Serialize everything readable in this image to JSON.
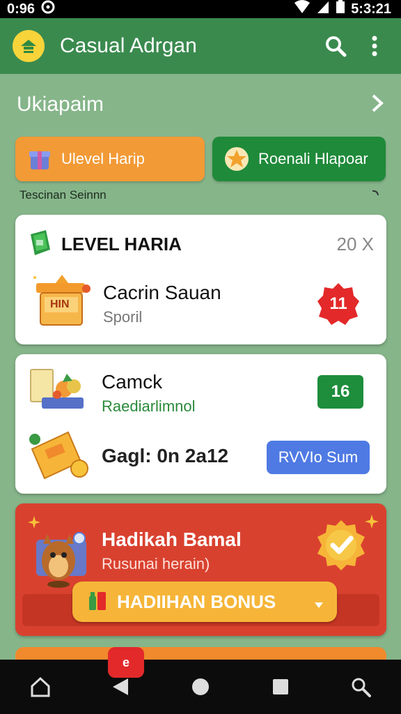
{
  "status_bar": {
    "time": "0:96",
    "clock": "5:3:21"
  },
  "app_bar": {
    "title": "Casual Adrgan",
    "icons": [
      "home-logo-icon",
      "search-icon",
      "more-vert-icon"
    ]
  },
  "section": {
    "title": "Ukiapaim"
  },
  "tabs": [
    {
      "label": "Ulevel Harip",
      "color": "#f29a36"
    },
    {
      "label": "Roenali Hlapoar",
      "color": "#1f8a3a"
    }
  ],
  "subtitle": "Tescinan Seinnn",
  "level_card": {
    "heading": "LEVEL HARIA",
    "count": "20 X",
    "item": {
      "title": "Cacrin Sauan",
      "subtitle": "Sporil",
      "badge": "11",
      "icon_text": "HIN"
    }
  },
  "second_card": {
    "item1": {
      "title": "Camck",
      "subtitle": "Raediarlimnol",
      "badge": "16"
    },
    "item2": {
      "title": "Gagl: 0n 2a12",
      "button": "RVVIo Sum"
    }
  },
  "bonus_card": {
    "title": "Hadikah Bamal",
    "subtitle": "Rusunai herain)",
    "button": "HADIIHAN BONUS"
  },
  "notification": {
    "badge": "e"
  },
  "colors": {
    "appbar": "#3a8a4e",
    "background": "#86b58a",
    "accent_orange": "#f29a36",
    "accent_green": "#1f8a3a",
    "bonus_red": "#d9412f"
  }
}
